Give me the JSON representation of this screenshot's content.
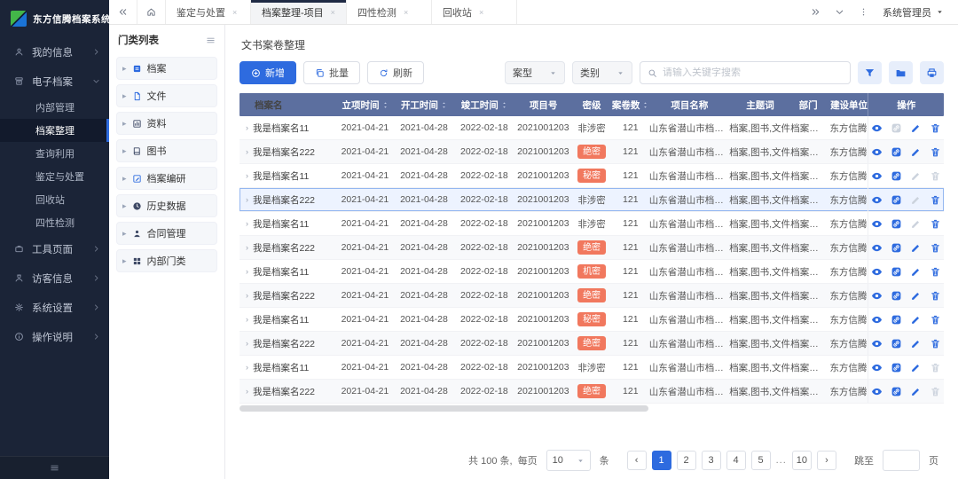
{
  "app": {
    "logo_text": "东方信腾档案系统"
  },
  "sidebar": {
    "items": [
      {
        "key": "my-info",
        "label": "我的信息",
        "icon": "user",
        "expanded": false
      },
      {
        "key": "e-archive",
        "label": "电子档案",
        "icon": "archive",
        "expanded": true,
        "children": [
          {
            "key": "internal-mgmt",
            "label": "内部管理",
            "active": false
          },
          {
            "key": "archive-organize",
            "label": "档案整理",
            "active": true
          },
          {
            "key": "query-use",
            "label": "查询利用",
            "active": false
          },
          {
            "key": "appraisal-disposal",
            "label": "鉴定与处置",
            "active": false
          },
          {
            "key": "recycle-bin",
            "label": "回收站",
            "active": false
          },
          {
            "key": "four-property-check",
            "label": "四性检测",
            "active": false
          }
        ]
      },
      {
        "key": "tools-page",
        "label": "工具页面",
        "icon": "briefcase",
        "expanded": false
      },
      {
        "key": "visitor-info",
        "label": "访客信息",
        "icon": "visitor",
        "expanded": false
      },
      {
        "key": "system-settings",
        "label": "系统设置",
        "icon": "gear",
        "expanded": false
      },
      {
        "key": "operation-guide",
        "label": "操作说明",
        "icon": "info",
        "expanded": false
      }
    ]
  },
  "topbar": {
    "tabs": [
      {
        "key": "appraisal-disposal",
        "label": "鉴定与处置",
        "active": false
      },
      {
        "key": "archive-organize-project",
        "label": "档案整理-项目",
        "active": true
      },
      {
        "key": "four-property-check",
        "label": "四性检测",
        "active": false
      },
      {
        "key": "recycle-bin",
        "label": "回收站",
        "active": false
      }
    ],
    "user": "系统管理员"
  },
  "tree": {
    "title": "门类列表",
    "items": [
      {
        "key": "archive",
        "label": "档案",
        "icon": "box-filled",
        "color": "#2e6bdf"
      },
      {
        "key": "file",
        "label": "文件",
        "icon": "doc",
        "color": "#2e6bdf"
      },
      {
        "key": "material",
        "label": "资料",
        "icon": "chart",
        "color": "#3f4a66"
      },
      {
        "key": "book",
        "label": "图书",
        "icon": "book",
        "color": "#3f4a66"
      },
      {
        "key": "archive-research",
        "label": "档案编研",
        "icon": "editdoc",
        "color": "#2e6bdf"
      },
      {
        "key": "history-data",
        "label": "历史数据",
        "icon": "clock-filled",
        "color": "#3f4a66"
      },
      {
        "key": "contract-mgmt",
        "label": "合同管理",
        "icon": "person-filled",
        "color": "#3f4a66"
      },
      {
        "key": "internal-category",
        "label": "内部门类",
        "icon": "grid-filled",
        "color": "#3f4a66"
      }
    ]
  },
  "main": {
    "title": "文书案卷整理",
    "toolbar": {
      "add_label": "新增",
      "batch_label": "批量",
      "refresh_label": "刷新",
      "filter_case_type": "案型",
      "filter_category": "类别",
      "search_placeholder": "请输入关键字搜索"
    },
    "table": {
      "columns": [
        {
          "label": "档案名",
          "sortable": false
        },
        {
          "label": "立项时间",
          "sortable": true
        },
        {
          "label": "开工时间",
          "sortable": true
        },
        {
          "label": "竣工时间",
          "sortable": true
        },
        {
          "label": "项目号",
          "sortable": false
        },
        {
          "label": "密级",
          "sortable": false
        },
        {
          "label": "案卷数",
          "sortable": true
        },
        {
          "label": "项目名称",
          "sortable": false
        },
        {
          "label": "主题词",
          "sortable": false
        },
        {
          "label": "部门",
          "sortable": false
        },
        {
          "label": "建设单位",
          "sortable": false
        },
        {
          "label": "操作",
          "sortable": false,
          "action": true
        }
      ],
      "rows": [
        {
          "name": "我是档案名11",
          "start_date": "2021-04-21",
          "open_date": "2021-04-28",
          "finish_date": "2022-02-18",
          "project_no": "2021001203",
          "level": "非涉密",
          "level_badge": false,
          "count": "121",
          "project_name": "山东省潜山市档案馆",
          "keywords": "档案,图书,文件",
          "dept": "档案中心",
          "unit": "东方信腾",
          "selected": false,
          "actions": {
            "view": true,
            "link": false,
            "edit": true,
            "delete": true
          }
        },
        {
          "name": "我是档案名222",
          "start_date": "2021-04-21",
          "open_date": "2021-04-28",
          "finish_date": "2022-02-18",
          "project_no": "2021001203",
          "level": "绝密",
          "level_badge": true,
          "count": "121",
          "project_name": "山东省潜山市档案馆",
          "keywords": "档案,图书,文件",
          "dept": "档案中心",
          "unit": "东方信腾",
          "selected": false,
          "actions": {
            "view": true,
            "link": true,
            "edit": true,
            "delete": true
          }
        },
        {
          "name": "我是档案名11",
          "start_date": "2021-04-21",
          "open_date": "2021-04-28",
          "finish_date": "2022-02-18",
          "project_no": "2021001203",
          "level": "秘密",
          "level_badge": true,
          "count": "121",
          "project_name": "山东省潜山市档案馆",
          "keywords": "档案,图书,文件",
          "dept": "档案中心",
          "unit": "东方信腾",
          "selected": false,
          "actions": {
            "view": true,
            "link": true,
            "edit": false,
            "delete": false
          }
        },
        {
          "name": "我是档案名222",
          "start_date": "2021-04-21",
          "open_date": "2021-04-28",
          "finish_date": "2022-02-18",
          "project_no": "2021001203",
          "level": "非涉密",
          "level_badge": false,
          "count": "121",
          "project_name": "山东省潜山市档案馆",
          "keywords": "档案,图书,文件",
          "dept": "档案中心",
          "unit": "东方信腾",
          "selected": true,
          "actions": {
            "view": true,
            "link": true,
            "edit": false,
            "delete": true
          }
        },
        {
          "name": "我是档案名11",
          "start_date": "2021-04-21",
          "open_date": "2021-04-28",
          "finish_date": "2022-02-18",
          "project_no": "2021001203",
          "level": "非涉密",
          "level_badge": false,
          "count": "121",
          "project_name": "山东省潜山市档案馆",
          "keywords": "档案,图书,文件",
          "dept": "档案中心",
          "unit": "东方信腾",
          "selected": false,
          "actions": {
            "view": true,
            "link": true,
            "edit": false,
            "delete": true
          }
        },
        {
          "name": "我是档案名222",
          "start_date": "2021-04-21",
          "open_date": "2021-04-28",
          "finish_date": "2022-02-18",
          "project_no": "2021001203",
          "level": "绝密",
          "level_badge": true,
          "count": "121",
          "project_name": "山东省潜山市档案馆",
          "keywords": "档案,图书,文件",
          "dept": "档案中心",
          "unit": "东方信腾",
          "selected": false,
          "actions": {
            "view": true,
            "link": true,
            "edit": true,
            "delete": true
          }
        },
        {
          "name": "我是档案名11",
          "start_date": "2021-04-21",
          "open_date": "2021-04-28",
          "finish_date": "2022-02-18",
          "project_no": "2021001203",
          "level": "机密",
          "level_badge": true,
          "count": "121",
          "project_name": "山东省潜山市档案馆",
          "keywords": "档案,图书,文件",
          "dept": "档案中心",
          "unit": "东方信腾",
          "selected": false,
          "actions": {
            "view": true,
            "link": true,
            "edit": true,
            "delete": true
          }
        },
        {
          "name": "我是档案名222",
          "start_date": "2021-04-21",
          "open_date": "2021-04-28",
          "finish_date": "2022-02-18",
          "project_no": "2021001203",
          "level": "绝密",
          "level_badge": true,
          "count": "121",
          "project_name": "山东省潜山市档案馆",
          "keywords": "档案,图书,文件",
          "dept": "档案中心",
          "unit": "东方信腾",
          "selected": false,
          "actions": {
            "view": true,
            "link": true,
            "edit": true,
            "delete": true
          }
        },
        {
          "name": "我是档案名11",
          "start_date": "2021-04-21",
          "open_date": "2021-04-28",
          "finish_date": "2022-02-18",
          "project_no": "2021001203",
          "level": "秘密",
          "level_badge": true,
          "count": "121",
          "project_name": "山东省潜山市档案馆",
          "keywords": "档案,图书,文件",
          "dept": "档案中心",
          "unit": "东方信腾",
          "selected": false,
          "actions": {
            "view": true,
            "link": true,
            "edit": true,
            "delete": true
          }
        },
        {
          "name": "我是档案名222",
          "start_date": "2021-04-21",
          "open_date": "2021-04-28",
          "finish_date": "2022-02-18",
          "project_no": "2021001203",
          "level": "绝密",
          "level_badge": true,
          "count": "121",
          "project_name": "山东省潜山市档案馆",
          "keywords": "档案,图书,文件",
          "dept": "档案中心",
          "unit": "东方信腾",
          "selected": false,
          "actions": {
            "view": true,
            "link": true,
            "edit": true,
            "delete": true
          }
        },
        {
          "name": "我是档案名11",
          "start_date": "2021-04-21",
          "open_date": "2021-04-28",
          "finish_date": "2022-02-18",
          "project_no": "2021001203",
          "level": "非涉密",
          "level_badge": false,
          "count": "121",
          "project_name": "山东省潜山市档案馆",
          "keywords": "档案,图书,文件",
          "dept": "档案中心",
          "unit": "东方信腾",
          "selected": false,
          "actions": {
            "view": true,
            "link": true,
            "edit": true,
            "delete": false
          }
        },
        {
          "name": "我是档案名222",
          "start_date": "2021-04-21",
          "open_date": "2021-04-28",
          "finish_date": "2022-02-18",
          "project_no": "2021001203",
          "level": "绝密",
          "level_badge": true,
          "count": "121",
          "project_name": "山东省潜山市档案馆",
          "keywords": "档案,图书,文件",
          "dept": "档案中心",
          "unit": "东方信腾",
          "selected": false,
          "actions": {
            "view": true,
            "link": true,
            "edit": true,
            "delete": false
          }
        }
      ]
    },
    "pagination": {
      "total_text": "共 100 条,",
      "per_page_prefix": "每页",
      "per_page_value": "10",
      "per_page_suffix": "条",
      "pages": [
        "1",
        "2",
        "3",
        "4",
        "5",
        "...",
        "10"
      ],
      "active_page": "1",
      "jump_prefix": "跳至",
      "jump_suffix": "页"
    }
  },
  "colors": {
    "accent": "#2e6bdf",
    "sidebar_bg": "#1b2437",
    "table_header_bg": "#5c6f9f",
    "badge_bg": "#f1785e"
  }
}
